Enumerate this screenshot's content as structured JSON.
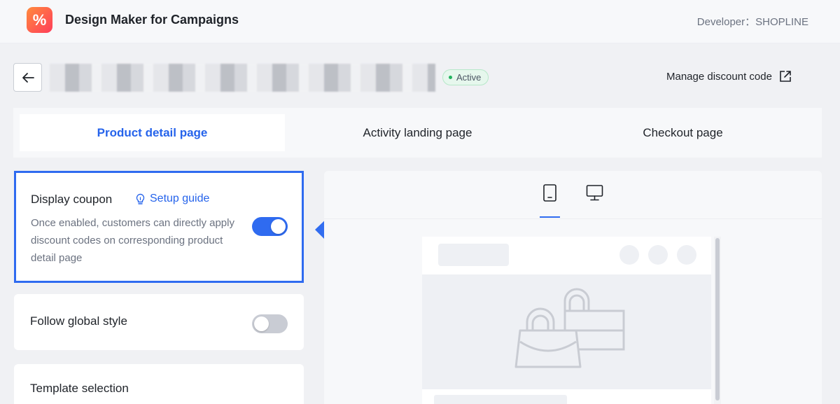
{
  "app": {
    "logo_glyph": "%",
    "title": "Design Maker for Campaigns",
    "developer": "Developer：SHOPLINE"
  },
  "header": {
    "status": "Active",
    "manage_link": "Manage discount code"
  },
  "tabs": [
    {
      "label": "Product detail page",
      "active": true
    },
    {
      "label": "Activity landing page",
      "active": false
    },
    {
      "label": "Checkout page",
      "active": false
    }
  ],
  "settings": {
    "display_coupon": {
      "title": "Display coupon",
      "guide_label": "Setup guide",
      "description": "Once enabled, customers can directly apply discount codes on corresponding product detail page",
      "enabled": true
    },
    "global_style": {
      "title": "Follow global style",
      "enabled": false
    },
    "template": {
      "title": "Template selection"
    }
  },
  "preview": {
    "devices": [
      "mobile-icon",
      "desktop-icon"
    ],
    "selected_device": "mobile"
  },
  "colors": {
    "accent": "#2f6bf0",
    "active_badge_bg": "#e6f7ed",
    "active_dot": "#22b35e",
    "logo_from": "#ff8a3d",
    "logo_to": "#ff3d5a"
  }
}
